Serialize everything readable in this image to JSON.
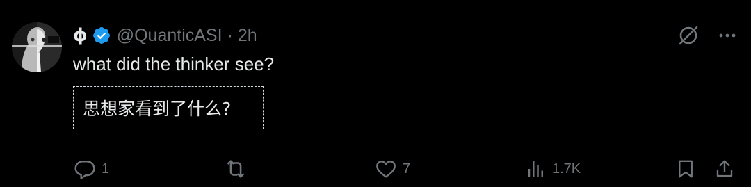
{
  "tweet": {
    "display_name": "ϕ",
    "verified_icon": "verified-badge-icon",
    "handle": "@QuanticASI",
    "separator": "·",
    "time": "2h",
    "text": "what did the thinker see?",
    "translation": "思想家看到了什么?"
  },
  "header_actions": {
    "grok_icon": "grok-icon",
    "more_icon": "more-icon"
  },
  "actions": {
    "reply": {
      "icon": "reply-icon",
      "count": "1"
    },
    "retweet": {
      "icon": "retweet-icon",
      "count": ""
    },
    "like": {
      "icon": "heart-icon",
      "count": "7"
    },
    "views": {
      "icon": "views-icon",
      "count": "1.7K"
    },
    "bookmark": {
      "icon": "bookmark-icon"
    },
    "share": {
      "icon": "share-icon"
    }
  },
  "colors": {
    "background": "#000000",
    "text": "#e7e9ea",
    "muted": "#71767b",
    "verified": "#1d9bf0"
  }
}
